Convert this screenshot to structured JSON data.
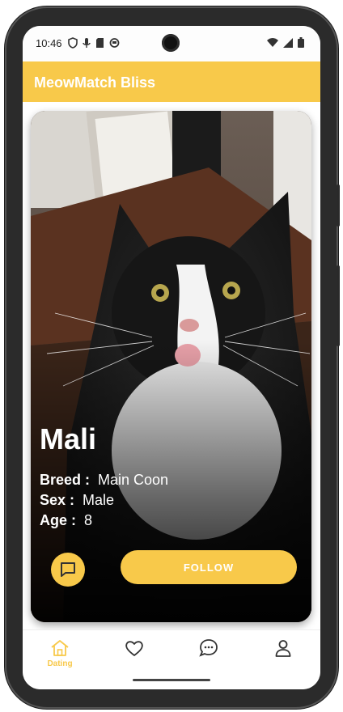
{
  "status": {
    "time": "10:46",
    "icons_left": [
      "shield-icon",
      "mic-icon",
      "sd-card-icon",
      "circle-icon"
    ],
    "icons_right": [
      "wifi-icon",
      "signal-icon",
      "battery-icon"
    ]
  },
  "app": {
    "title": "MeowMatch Bliss"
  },
  "profile": {
    "name": "Mali",
    "fields": [
      {
        "key": "Breed :",
        "value": "Main Coon"
      },
      {
        "key": "Sex :",
        "value": "Male"
      },
      {
        "key": "Age :",
        "value": "8"
      }
    ]
  },
  "actions": {
    "chat_icon": "chat-bubble-icon",
    "follow_label": "FOLLOW"
  },
  "nav": {
    "items": [
      {
        "label": "Dating",
        "icon": "home-icon",
        "active": true
      },
      {
        "label": "",
        "icon": "heart-icon",
        "active": false
      },
      {
        "label": "",
        "icon": "chat-icon",
        "active": false
      },
      {
        "label": "",
        "icon": "profile-icon",
        "active": false
      }
    ]
  },
  "colors": {
    "accent": "#f8c94a",
    "text_on_accent": "#ffffff"
  }
}
